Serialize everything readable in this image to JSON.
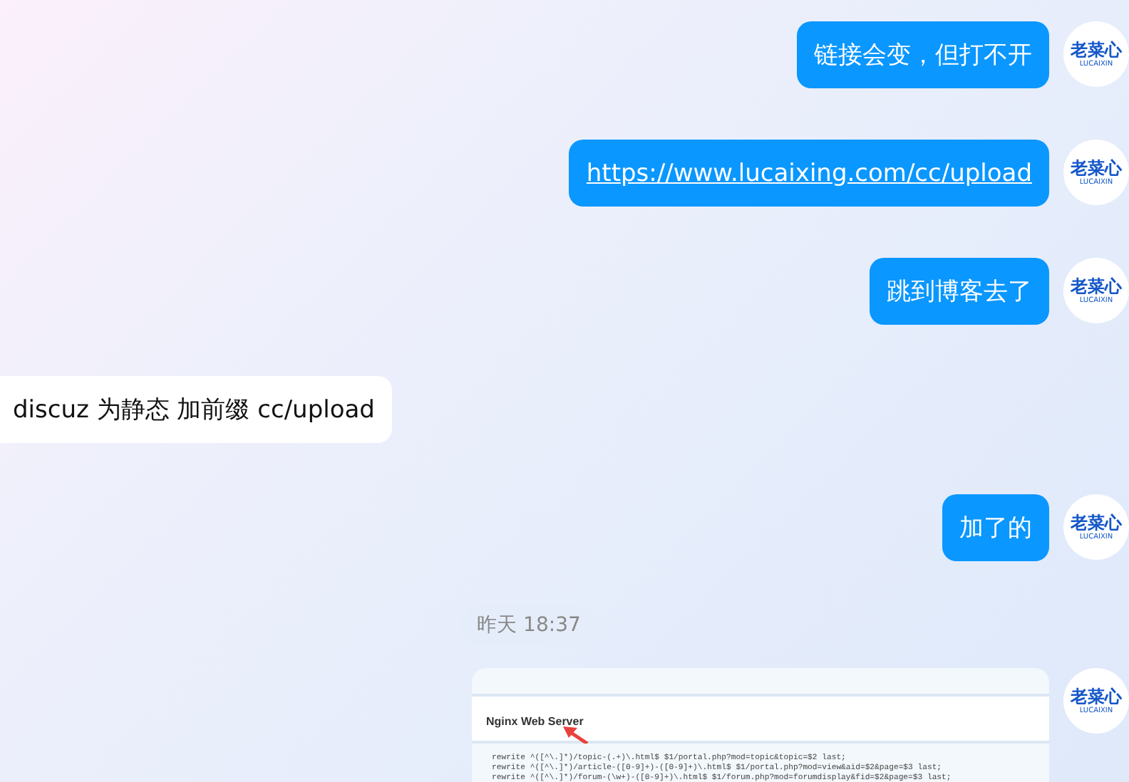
{
  "messages": [
    {
      "kind": "text",
      "outgoing": true,
      "text": "链接会变，但打不开",
      "avatar": {
        "logo": "老菜心",
        "sub": "LUCAIXIN"
      }
    },
    {
      "kind": "link",
      "outgoing": true,
      "text": "https://www.lucaixing.com/cc/upload",
      "avatar": {
        "logo": "老菜心",
        "sub": "LUCAIXIN"
      }
    },
    {
      "kind": "text",
      "outgoing": true,
      "text": "跳到博客去了",
      "avatar": {
        "logo": "老菜心",
        "sub": "LUCAIXIN"
      }
    },
    {
      "kind": "text",
      "outgoing": false,
      "text": "discuz 为静态 加前缀 cc/upload"
    },
    {
      "kind": "text",
      "outgoing": true,
      "text": "加了的",
      "avatar": {
        "logo": "老菜心",
        "sub": "LUCAIXIN"
      }
    },
    {
      "kind": "time",
      "text": "昨天 18:37"
    },
    {
      "kind": "image",
      "outgoing": true,
      "heading": "Nginx Web Server",
      "code": [
        "rewrite ^([^\\.]*)/topic-(.+)\\.html$ $1/portal.php?mod=topic&topic=$2 last;",
        "rewrite ^([^\\.]*)/article-([0-9]+)-([0-9]+)\\.html$ $1/portal.php?mod=view&aid=$2&page=$3 last;",
        "rewrite ^([^\\.]*)/forum-(\\w+)-([0-9]+)\\.html$ $1/forum.php?mod=forumdisplay&fid=$2&page=$3 last;"
      ],
      "avatar": {
        "logo": "老菜心",
        "sub": "LUCAIXIN"
      }
    }
  ]
}
